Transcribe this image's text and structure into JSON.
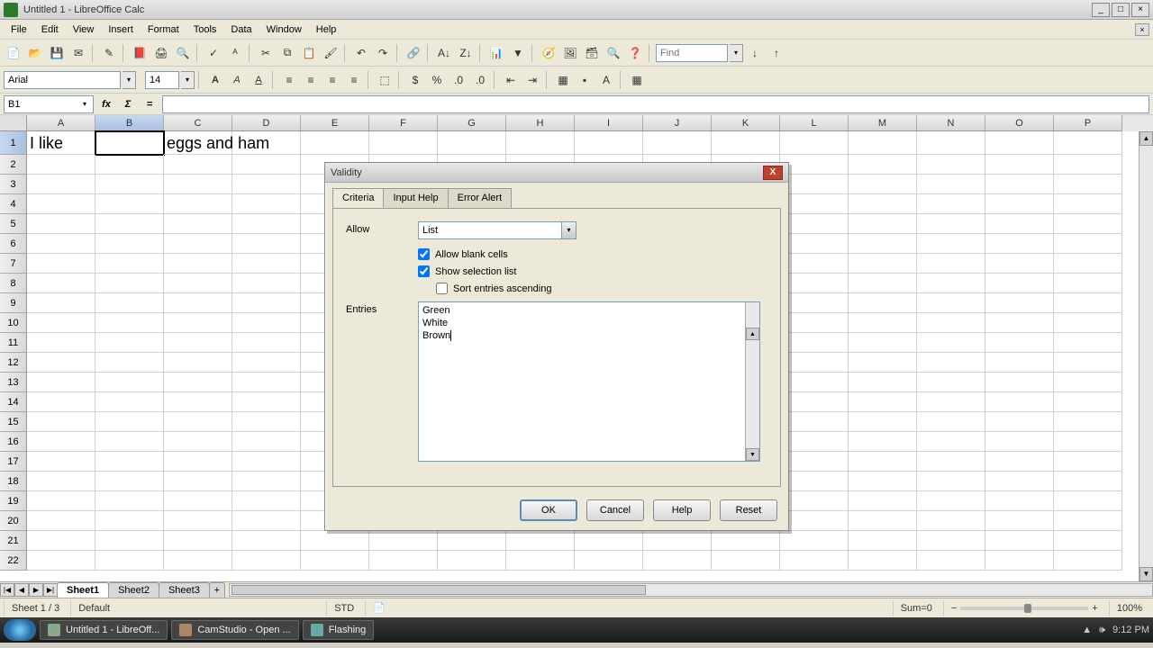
{
  "window": {
    "title": "Untitled 1 - LibreOffice Calc"
  },
  "menus": [
    "File",
    "Edit",
    "View",
    "Insert",
    "Format",
    "Tools",
    "Data",
    "Window",
    "Help"
  ],
  "find_placeholder": "Find",
  "font": {
    "name": "Arial",
    "size": "14"
  },
  "namebox": "B1",
  "columns": [
    "A",
    "B",
    "C",
    "D",
    "E",
    "F",
    "G",
    "H",
    "I",
    "J",
    "K",
    "L",
    "M",
    "N",
    "O",
    "P"
  ],
  "rows_count": 22,
  "cells": {
    "A1": "I like",
    "C1": "eggs and ham"
  },
  "selected_cell": "B1",
  "sheet_tabs": [
    "Sheet1",
    "Sheet2",
    "Sheet3"
  ],
  "active_sheet": "Sheet1",
  "status": {
    "sheet": "Sheet 1 / 3",
    "style": "Default",
    "mode": "STD",
    "sum": "Sum=0",
    "zoom": "100%"
  },
  "dialog": {
    "title": "Validity",
    "tabs": [
      "Criteria",
      "Input Help",
      "Error Alert"
    ],
    "active_tab": "Criteria",
    "allow_label": "Allow",
    "allow_value": "List",
    "allow_blank": {
      "label": "Allow blank cells",
      "checked": true
    },
    "show_list": {
      "label": "Show selection list",
      "checked": true
    },
    "sort_asc": {
      "label": "Sort entries ascending",
      "checked": false
    },
    "entries_label": "Entries",
    "entries_text": "Green\nWhite\nBrown",
    "buttons": {
      "ok": "OK",
      "cancel": "Cancel",
      "help": "Help",
      "reset": "Reset"
    }
  },
  "taskbar": {
    "items": [
      "Untitled 1 - LibreOff...",
      "CamStudio - Open ...",
      "Flashing"
    ],
    "time": "9:12 PM"
  }
}
